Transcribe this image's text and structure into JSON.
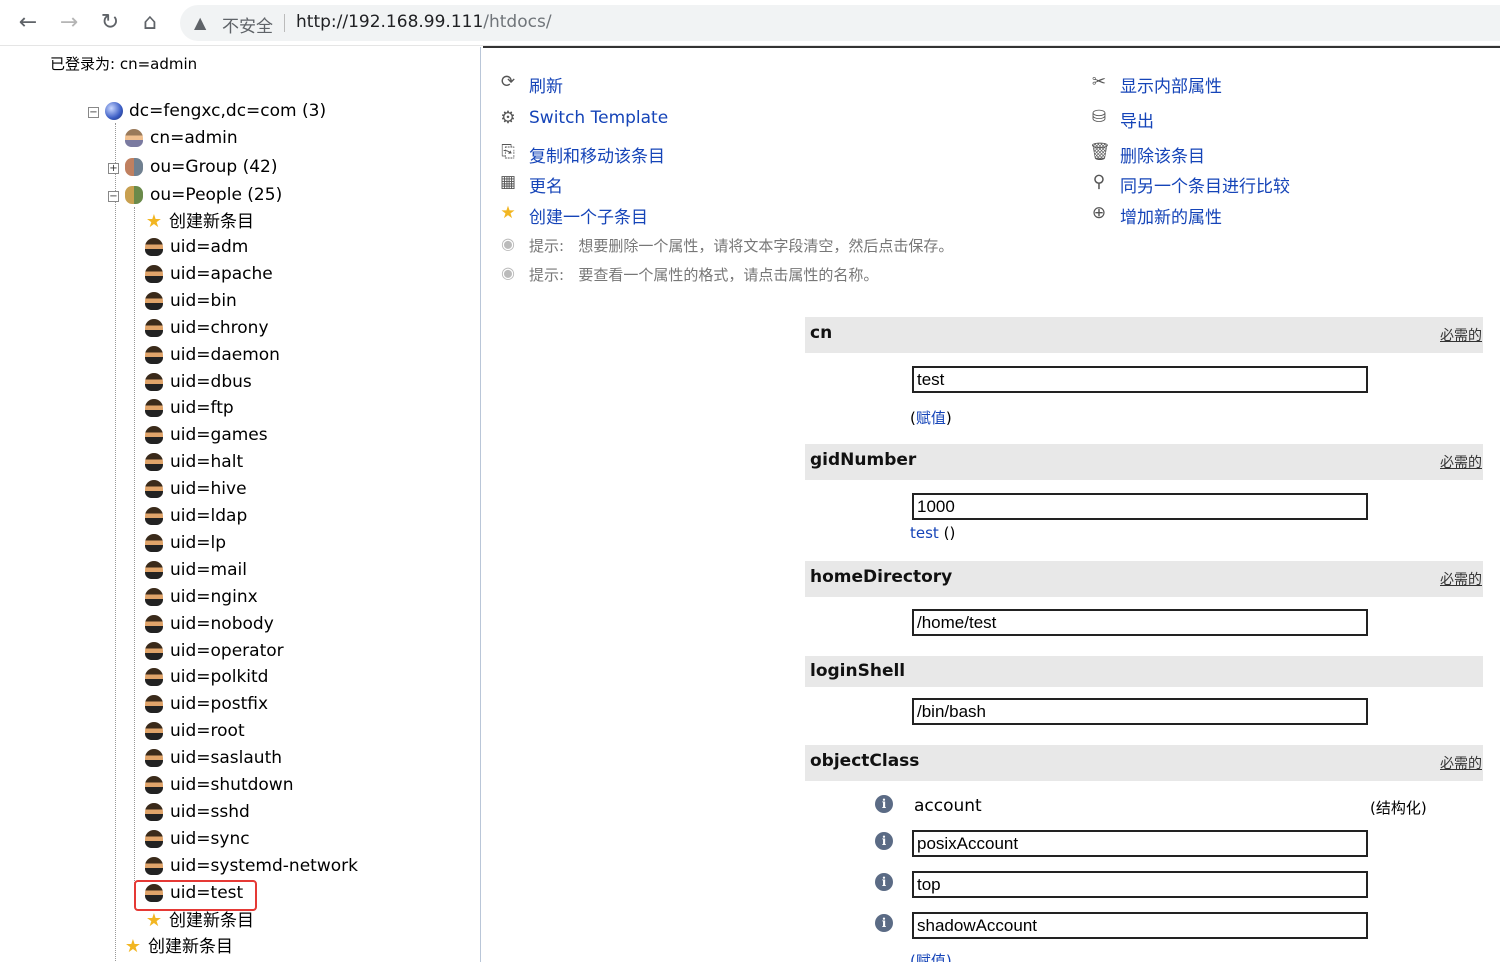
{
  "browser": {
    "back_icon": "←",
    "forward_icon": "→",
    "reload_icon": "↻",
    "home_icon": "⌂",
    "security_label": "不安全",
    "url_host": "http://192.168.99.111",
    "url_path": "/htdocs/"
  },
  "tree": {
    "logged_in": "已登录为: cn=admin",
    "root": "dc=fengxc,dc=com (3)",
    "admin": "cn=admin",
    "group": "ou=Group (42)",
    "people": "ou=People (25)",
    "create_new": "创建新条目",
    "users": [
      "uid=adm",
      "uid=apache",
      "uid=bin",
      "uid=chrony",
      "uid=daemon",
      "uid=dbus",
      "uid=ftp",
      "uid=games",
      "uid=halt",
      "uid=hive",
      "uid=ldap",
      "uid=lp",
      "uid=mail",
      "uid=nginx",
      "uid=nobody",
      "uid=operator",
      "uid=polkitd",
      "uid=postfix",
      "uid=root",
      "uid=saslauth",
      "uid=shutdown",
      "uid=sshd",
      "uid=sync",
      "uid=systemd-network",
      "uid=test"
    ],
    "people_create": "创建新条目",
    "root_create": "创建新条目",
    "highlight_color": "#e53935"
  },
  "actions": {
    "refresh": "刷新",
    "switch_template": "Switch Template",
    "copy_move": "复制和移动该条目",
    "rename": "更名",
    "create_child": "创建一个子条目",
    "show_internal": "显示内部属性",
    "export": "导出",
    "delete": "删除该条目",
    "compare": "同另一个条目进行比较",
    "add_attr": "增加新的属性",
    "link_color": "#1544b8"
  },
  "hints": {
    "label": "提示:",
    "hint1": "想要删除一个属性，请将文本字段清空，然后点击保存。",
    "hint2": "要查看一个属性的格式，请点击属性的名称。"
  },
  "attributes": {
    "required_label": "必需的",
    "cn": {
      "name": "cn",
      "value": "test",
      "assign": "赋值"
    },
    "gidNumber": {
      "name": "gidNumber",
      "value": "1000",
      "group_link": "test",
      "group_paren": "()"
    },
    "homeDirectory": {
      "name": "homeDirectory",
      "value": "/home/test"
    },
    "loginShell": {
      "name": "loginShell",
      "value": "/bin/bash"
    },
    "objectClass": {
      "name": "objectClass",
      "first": "account",
      "structural": "(结构化)",
      "values": [
        "posixAccount",
        "top",
        "shadowAccount"
      ],
      "assign": "(赋值)"
    }
  }
}
